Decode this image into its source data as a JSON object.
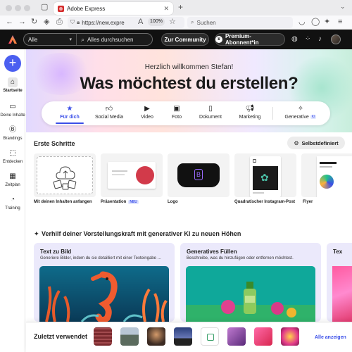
{
  "browser": {
    "tab_title": "Adobe Express",
    "url": "https://new.expre",
    "zoom": "100%",
    "search_placeholder": "Suchen"
  },
  "header": {
    "search_scope": "Alle",
    "search_placeholder": "Alles durchsuchen",
    "community_label": "Zur Community",
    "premium_label": "Premium-Abonnent*in"
  },
  "sidebar": {
    "items": [
      {
        "label": "Startseite",
        "icon": "home-icon",
        "active": true
      },
      {
        "label": "Deine Inhalte",
        "icon": "folder-icon"
      },
      {
        "label": "Brandings",
        "icon": "brand-icon"
      },
      {
        "label": "Entdecken",
        "icon": "discover-icon"
      },
      {
        "label": "Zeitplan",
        "icon": "calendar-icon"
      },
      {
        "label": "Training",
        "icon": "bulb-icon"
      }
    ]
  },
  "hero": {
    "greeting": "Herzlich willkommen Stefan!",
    "headline": "Was möchtest du erstellen?",
    "categories": [
      {
        "label": "Für dich",
        "active": true
      },
      {
        "label": "Social Media"
      },
      {
        "label": "Video"
      },
      {
        "label": "Foto"
      },
      {
        "label": "Dokument"
      },
      {
        "label": "Marketing"
      },
      {
        "label": "Generative",
        "badge": "KI"
      }
    ]
  },
  "first_steps": {
    "title": "Erste Schritte",
    "custom_button": "Selbstdefiniert",
    "tiles": [
      {
        "label": "Mit deinen Inhalten anfangen"
      },
      {
        "label": "Präsentation",
        "badge": "NEU"
      },
      {
        "label": "Logo"
      },
      {
        "label": "Quadratischer Instagram-Post"
      },
      {
        "label": "Flyer"
      }
    ]
  },
  "ai_section": {
    "title": "Verhilf deiner Vorstellungskraft mit generativer KI zu neuen Höhen",
    "cards": [
      {
        "title": "Text zu Bild",
        "desc": "Generiere Bilder, indem du sie detailliert mit einer Texteingabe ..."
      },
      {
        "title": "Generatives Füllen",
        "desc": "Beschreibe, was du hinzufügen oder entfernen möchtest."
      },
      {
        "title": "Tex"
      }
    ]
  },
  "recent": {
    "title": "Zuletzt verwendet",
    "show_all": "Alle anzeigen"
  },
  "colors": {
    "accent": "#3a4ee8",
    "create_button": "#4b5ff0",
    "header_bg": "#111111"
  }
}
